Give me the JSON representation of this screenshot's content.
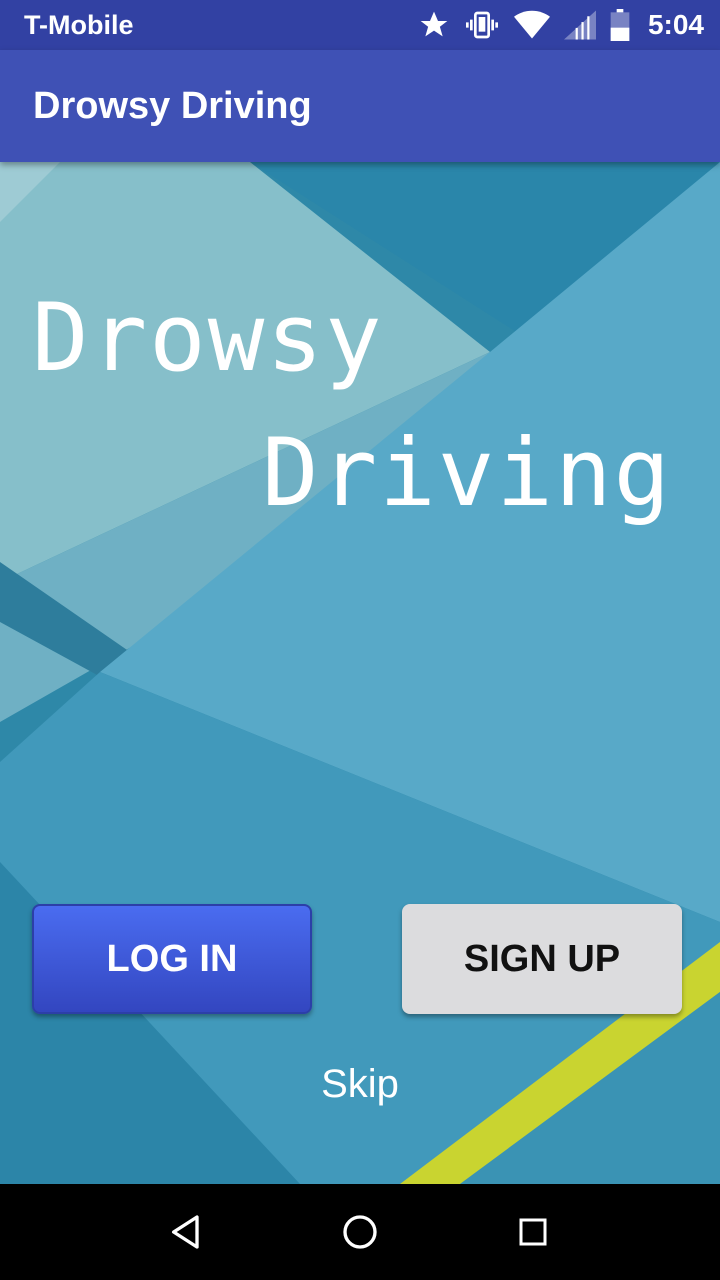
{
  "status_bar": {
    "carrier": "T-Mobile",
    "time": "5:04",
    "icons": [
      "star-icon",
      "vibrate-icon",
      "wifi-icon",
      "cell-signal-icon",
      "battery-icon"
    ]
  },
  "app_bar": {
    "title": "Drowsy Driving"
  },
  "hero": {
    "line1": "Drowsy",
    "line2": "Driving"
  },
  "buttons": {
    "login_label": "LOG IN",
    "signup_label": "SIGN UP",
    "skip_label": "Skip"
  },
  "nav_bar": {
    "icons": [
      "back-icon",
      "home-icon",
      "recents-icon"
    ]
  },
  "colors": {
    "status_bar": "#3241a3",
    "app_bar": "#3f51b5",
    "login_button": "#3f51b5",
    "signup_button": "#dcdcde"
  }
}
